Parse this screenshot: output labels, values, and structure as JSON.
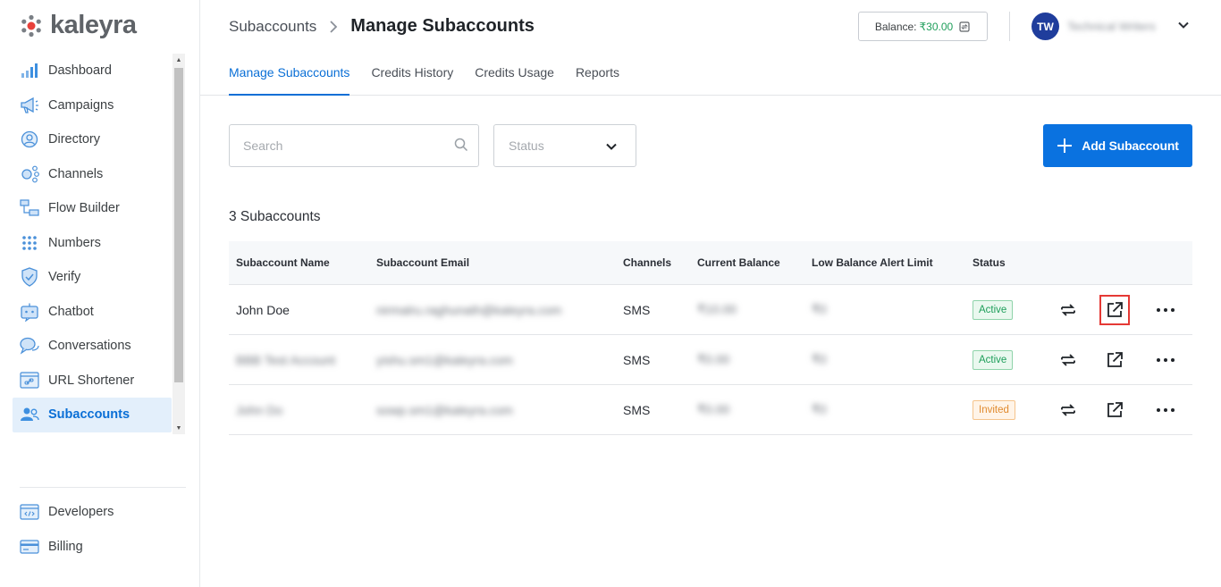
{
  "app": {
    "logo_text": "kaleyra"
  },
  "sidebar": {
    "items": [
      {
        "label": "Dashboard",
        "icon": "bar-chart-icon"
      },
      {
        "label": "Campaigns",
        "icon": "megaphone-icon"
      },
      {
        "label": "Directory",
        "icon": "user-circle-icon"
      },
      {
        "label": "Channels",
        "icon": "channels-icon"
      },
      {
        "label": "Flow Builder",
        "icon": "flow-icon"
      },
      {
        "label": "Numbers",
        "icon": "dial-pad-icon"
      },
      {
        "label": "Verify",
        "icon": "shield-check-icon"
      },
      {
        "label": "Chatbot",
        "icon": "chatbot-icon"
      },
      {
        "label": "Conversations",
        "icon": "chat-bubble-icon"
      },
      {
        "label": "URL Shortener",
        "icon": "link-icon"
      },
      {
        "label": "Subaccounts",
        "icon": "users-icon"
      }
    ],
    "active": "Subaccounts",
    "bottom_items": [
      {
        "label": "Developers",
        "icon": "code-icon"
      },
      {
        "label": "Billing",
        "icon": "card-icon"
      }
    ]
  },
  "header": {
    "breadcrumb_parent": "Subaccounts",
    "title": "Manage Subaccounts",
    "balance_label": "Balance:",
    "balance_value": "₹30.00",
    "avatar_initials": "TW",
    "user_name": "Technical Writers",
    "tabs": [
      "Manage Subaccounts",
      "Credits History",
      "Credits Usage",
      "Reports"
    ],
    "active_tab": "Manage Subaccounts"
  },
  "filters": {
    "search_placeholder": "Search",
    "status_placeholder": "Status",
    "add_button_label": "Add Subaccount"
  },
  "count_label": "3 Subaccounts",
  "table": {
    "columns": [
      "Subaccount Name",
      "Subaccount Email",
      "Channels",
      "Current Balance",
      "Low Balance Alert Limit",
      "Status"
    ],
    "rows": [
      {
        "name": "John Doe",
        "email": "nirmalru.raghunath@kaleyra.com",
        "channels": "SMS",
        "balance": "₹10.00",
        "low_alert": "₹0",
        "status": "Active",
        "name_blurred": false
      },
      {
        "name": "BBB Test Account",
        "email": "yishu.sm1@kaleyra.com",
        "channels": "SMS",
        "balance": "₹0.00",
        "low_alert": "₹0",
        "status": "Active",
        "name_blurred": true
      },
      {
        "name": "John Do",
        "email": "sowp.sm1@kaleyra.com",
        "channels": "SMS",
        "balance": "₹0.00",
        "low_alert": "₹0",
        "status": "Invited",
        "name_blurred": true
      }
    ]
  },
  "colors": {
    "accent": "#0a72e0",
    "active_green": "#1e9e5a",
    "invited_orange": "#e08a2e",
    "highlight_red": "#e53935"
  }
}
